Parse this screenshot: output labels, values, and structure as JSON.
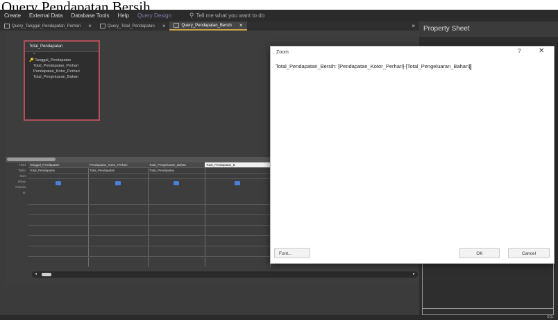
{
  "caption": "Query Pendapatan Bersih",
  "ribbon": {
    "items": [
      "Create",
      "External Data",
      "Database Tools",
      "Help"
    ],
    "context_tab": "Query Design",
    "tell_me": "Tell me what you want to do"
  },
  "doc_tabs": [
    {
      "label": "Query_Tanggal_Pendapatan_Perhari"
    },
    {
      "label": "Query_Total_Pendapatan"
    },
    {
      "label": "Query_Pendapatan_Bersih"
    }
  ],
  "table_box": {
    "title": "Total_Pendapatan",
    "fields": [
      "*",
      "Tanggal_Pendapatan",
      "Total_Pendapatan_Perhari",
      "Pendapatan_Kotor_Perhari",
      "Total_Pengeluaran_Bahan"
    ]
  },
  "grid": {
    "row_labels": [
      "Field:",
      "Table:",
      "Sort:",
      "Show:",
      "Criteria:",
      "or:"
    ],
    "columns": [
      {
        "field": "Tanggal_Pendapatan",
        "table": "Total_Pendapatan"
      },
      {
        "field": "Pendapatan_Kotor_Perhari",
        "table": "Total_Pendapatan"
      },
      {
        "field": "Total_Pengeluaran_Bahan",
        "table": "Total_Pendapatan"
      },
      {
        "field": "Total_Pendapatan_B",
        "table": ""
      }
    ]
  },
  "property_sheet": {
    "title": "Property Sheet"
  },
  "zoom_dialog": {
    "title": "Zoom",
    "help": "?",
    "close": "✕",
    "expression": "Total_Pendapatan_Bersih: [Pendapatan_Kotor_Perhari]-[Total_Pengeluaran_Bahan]",
    "font_button": "Font...",
    "ok_button": "OK",
    "cancel_button": "Cancel"
  },
  "status": {
    "right": "SQL"
  }
}
